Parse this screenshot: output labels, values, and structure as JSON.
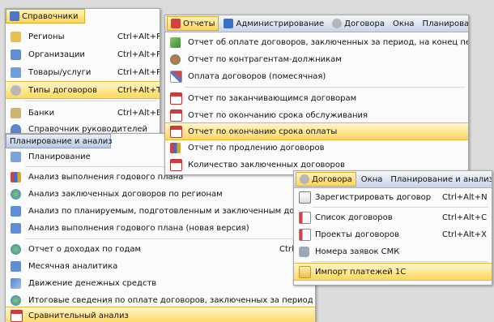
{
  "left_menu": {
    "title": "Справочники",
    "items": [
      {
        "label": "Регионы",
        "shortcut": "Ctrl+Alt+R",
        "icon": "map-icon"
      },
      {
        "label": "Организации",
        "shortcut": "Ctrl+Alt+F",
        "icon": "organization-icon"
      },
      {
        "label": "Товары/услуги",
        "shortcut": "Ctrl+Alt+P",
        "icon": "goods-icon"
      },
      {
        "label": "Типы договоров",
        "shortcut": "Ctrl+Alt+T",
        "icon": "contract-types-icon"
      },
      {
        "label": "Банки",
        "shortcut": "Ctrl+Alt+B",
        "icon": "bank-icon"
      },
      {
        "label": "Справочник руководителей",
        "shortcut": "",
        "icon": "person-icon"
      }
    ]
  },
  "planning_menu": {
    "title": "Планирование и анализ",
    "items": [
      {
        "label": "Планирование",
        "shortcut": "",
        "icon": "planning-icon"
      },
      {
        "label": "Анализ выполнения годового плана",
        "shortcut": "",
        "icon": "bar-chart-icon"
      },
      {
        "label": "Анализ заключенных договоров по регионам",
        "shortcut": "",
        "icon": "globe-icon"
      },
      {
        "label": "Анализ по планируемым, подготовленным и заключенным договорам",
        "shortcut": "",
        "icon": "table-icon"
      },
      {
        "label": "Анализ выполнения годового плана (новая версия)",
        "shortcut": "",
        "icon": "table-icon"
      },
      {
        "label": "Отчет о доходах по годам",
        "shortcut": "Ctrl-",
        "icon": "globe-icon"
      },
      {
        "label": "Месячная аналитика",
        "shortcut": "",
        "icon": "table-icon"
      },
      {
        "label": "Движение денежных средств",
        "shortcut": "",
        "icon": "cash-flow-icon"
      },
      {
        "label": "Итоговые сведения по оплате договоров, заключенных за период",
        "shortcut": "",
        "icon": "globe-icon"
      },
      {
        "label": "Сравнительный анализ",
        "shortcut": "",
        "icon": "calendar-icon"
      }
    ]
  },
  "reports_menu": {
    "menubar": [
      {
        "label": "Отчеты",
        "icon": "report-icon"
      },
      {
        "label": "Администрирование",
        "icon": "admin-icon"
      },
      {
        "label": "Договора",
        "icon": "contracts-icon"
      },
      {
        "label": "Окна",
        "icon": ""
      },
      {
        "label": "Планирование",
        "icon": ""
      }
    ],
    "items": [
      {
        "label": "Отчет об оплате договоров, заключенных за период, на конец периода",
        "icon": "pencil-icon"
      },
      {
        "label": "Отчет по контрагентам-должникам",
        "icon": "people-icon"
      },
      {
        "label": "Оплата договоров (помесячная)",
        "icon": "chart-icon"
      },
      {
        "label": "Отчет по заканчивающимся договорам",
        "icon": "calendar-icon"
      },
      {
        "label": "Отчет по окончанию срока обслуживания",
        "icon": "calendar-icon"
      },
      {
        "label": "Отчет по окончанию срока оплаты",
        "icon": "calendar-icon"
      },
      {
        "label": "Отчет по продлению договоров",
        "icon": "bar-chart-icon"
      },
      {
        "label": "Количество заключенных договоров",
        "icon": "calendar-icon"
      }
    ]
  },
  "contracts_menu": {
    "menubar": [
      {
        "label": "Договора",
        "icon": "contracts-icon"
      },
      {
        "label": "Окна",
        "icon": ""
      },
      {
        "label": "Планирование и анализ",
        "icon": ""
      }
    ],
    "items": [
      {
        "label": "Зарегистрировать договор",
        "shortcut": "Ctrl+Alt+N",
        "icon": "register-icon"
      },
      {
        "label": "Список договоров",
        "shortcut": "Ctrl+Alt+C",
        "icon": "list-icon"
      },
      {
        "label": "Проекты договоров",
        "shortcut": "Ctrl+Alt+X",
        "icon": "document-icon"
      },
      {
        "label": "Номера заявок СМК",
        "shortcut": "",
        "icon": "numbers-icon"
      },
      {
        "label": "Импорт платежей 1С",
        "shortcut": "",
        "icon": "import-icon"
      }
    ]
  },
  "colors": {
    "highlight": "#ffd760",
    "menubar": "#c9d4e6"
  }
}
